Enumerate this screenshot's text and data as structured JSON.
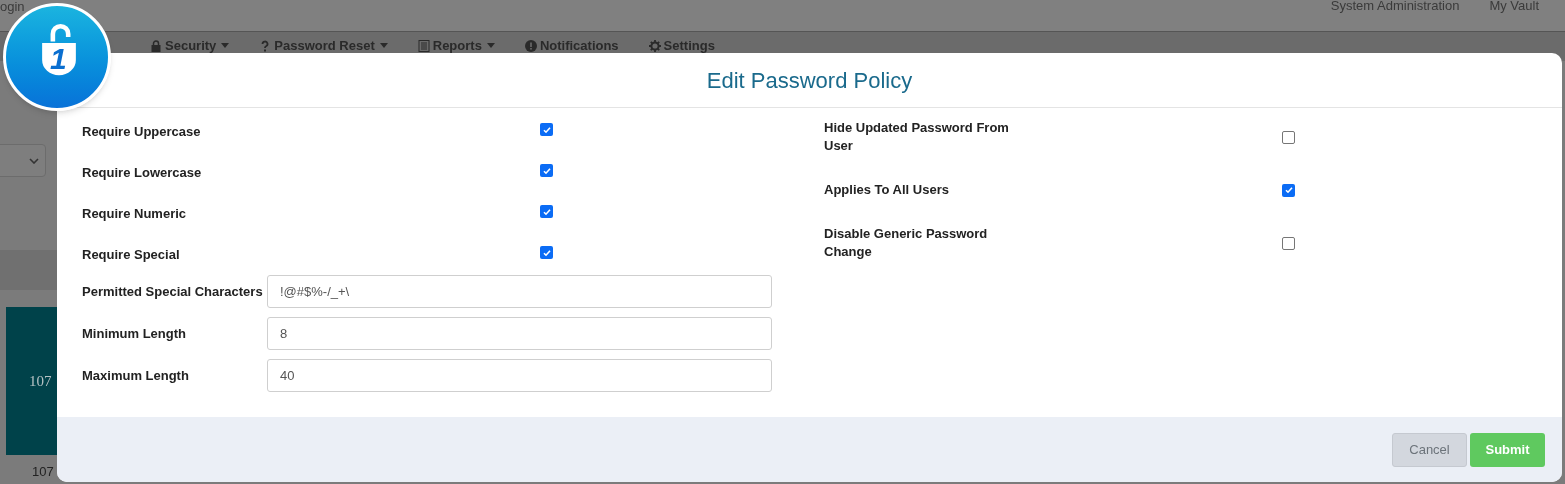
{
  "background": {
    "top_bar": {
      "left_text": "ogin",
      "links": [
        "System Administration",
        "My Vault"
      ]
    },
    "nav": [
      {
        "label": "Security",
        "kind": "lock",
        "dropdown": true
      },
      {
        "label": "Password Reset",
        "kind": "question",
        "dropdown": true
      },
      {
        "label": "Reports",
        "kind": "list",
        "dropdown": true
      },
      {
        "label": "Notifications",
        "kind": "alert",
        "dropdown": false
      },
      {
        "label": "Settings",
        "kind": "gear",
        "dropdown": false
      }
    ],
    "tile_value": "107",
    "tile_caption": "107"
  },
  "logo": {
    "text": "1"
  },
  "dialog": {
    "title": "Edit Password Policy",
    "left_checks": [
      {
        "label": "Require Uppercase",
        "checked": true
      },
      {
        "label": "Require Lowercase",
        "checked": true
      },
      {
        "label": "Require Numeric",
        "checked": true
      },
      {
        "label": "Require Special",
        "checked": true
      }
    ],
    "fields": [
      {
        "label": "Permitted Special Characters",
        "value": "!@#$%-/_+\\"
      },
      {
        "label": "Minimum Length",
        "value": "8"
      },
      {
        "label": "Maximum Length",
        "value": "40"
      }
    ],
    "right_checks": [
      {
        "label": "Hide Updated Password From User",
        "checked": false
      },
      {
        "label": "Applies To All Users",
        "checked": true
      },
      {
        "label": "Disable Generic Password Change",
        "checked": false
      }
    ],
    "buttons": [
      {
        "label": "Cancel",
        "kind": "secondary"
      },
      {
        "label": "Submit",
        "kind": "primary"
      }
    ]
  }
}
